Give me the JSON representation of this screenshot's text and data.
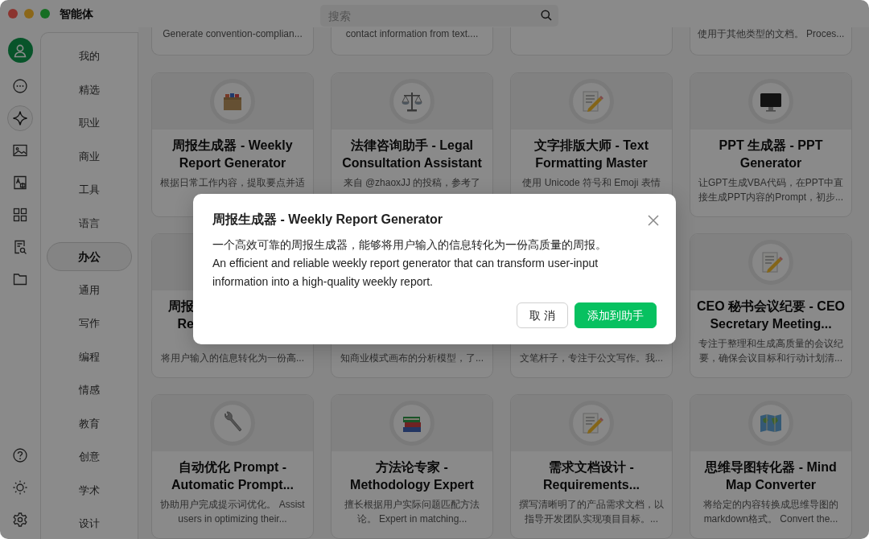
{
  "window": {
    "title": "智能体"
  },
  "search": {
    "placeholder": "搜索"
  },
  "nav_rail": [
    {
      "selected": false
    },
    {
      "selected": true
    },
    {
      "selected": false
    },
    {
      "selected": false
    },
    {
      "selected": false
    },
    {
      "selected": false
    },
    {
      "selected": false
    }
  ],
  "categories": [
    {
      "label": "我的",
      "selected": false
    },
    {
      "label": "精选",
      "selected": false
    },
    {
      "label": "职业",
      "selected": false
    },
    {
      "label": "商业",
      "selected": false
    },
    {
      "label": "工具",
      "selected": false
    },
    {
      "label": "语言",
      "selected": false
    },
    {
      "label": "办公",
      "selected": true
    },
    {
      "label": "通用",
      "selected": false
    },
    {
      "label": "写作",
      "selected": false
    },
    {
      "label": "编程",
      "selected": false
    },
    {
      "label": "情感",
      "selected": false
    },
    {
      "label": "教育",
      "selected": false
    },
    {
      "label": "创意",
      "selected": false
    },
    {
      "label": "学术",
      "selected": false
    },
    {
      "label": "设计",
      "selected": false
    }
  ],
  "cards": [
    {
      "kind": "clipped",
      "description_lines": [
        "Generate convention-complian..."
      ]
    },
    {
      "kind": "clipped",
      "description_lines": [
        "contact information from text...."
      ]
    },
    {
      "kind": "clipped"
    },
    {
      "kind": "clipped",
      "description_lines": [
        "使用于其他类型的文档。 Proces..."
      ]
    },
    {
      "kind": "full",
      "title_lines": [
        "周报生成器 - Weekly",
        "Report Generator"
      ],
      "description_lines": [
        "根据日常工作内容，提取要点并适"
      ]
    },
    {
      "kind": "full",
      "title_lines": [
        "法律咨询助手 - Legal",
        "Consultation Assistant"
      ],
      "description_lines": [
        "来自 @zhaoxJJ 的投稿，参考了"
      ]
    },
    {
      "kind": "full",
      "title_lines": [
        "文字排版大师 - Text",
        "Formatting Master"
      ],
      "description_lines": [
        "使用 Unicode 符号和 Emoji 表情"
      ]
    },
    {
      "kind": "full",
      "title_lines": [
        "PPT 生成器 - PPT",
        "Generator"
      ],
      "description_lines": [
        "让GPT生成VBA代码，在PPT中直",
        "接生成PPT内容的Prompt，初步..."
      ]
    },
    {
      "kind": "covered",
      "title_lines": [
        "周报",
        "Re"
      ],
      "description_lines": [
        "将用户输入的信息转化为一份高..."
      ]
    },
    {
      "kind": "covered",
      "description_lines": [
        "知商业模式画布的分析模型，了..."
      ]
    },
    {
      "kind": "covered",
      "description_lines": [
        "文笔杆子，专注于公文写作。我..."
      ]
    },
    {
      "kind": "full",
      "title_lines": [
        "CEO 秘书会议纪要 - CEO",
        "Secretary Meeting..."
      ],
      "description_lines": [
        "专注于整理和生成高质量的会议纪",
        "要，确保会议目标和行动计划清..."
      ]
    },
    {
      "kind": "full",
      "title_lines": [
        "自动优化 Prompt -",
        "Automatic Prompt..."
      ],
      "description_lines": [
        "协助用户完成提示词优化。 Assist",
        "users in optimizing their..."
      ]
    },
    {
      "kind": "full",
      "title_lines": [
        "方法论专家 -",
        "Methodology Expert"
      ],
      "description_lines": [
        "擅长根据用户实际问题匹配方法",
        "论。 Expert in matching..."
      ]
    },
    {
      "kind": "full",
      "title_lines": [
        "需求文档设计 -",
        "Requirements..."
      ],
      "description_lines": [
        "撰写清晰明了的产品需求文档，以",
        "指导开发团队实现项目目标。..."
      ]
    },
    {
      "kind": "full",
      "title_lines": [
        "思维导图转化器 - Mind",
        "Map Converter"
      ],
      "description_lines": [
        "将给定的内容转换成思维导图的",
        "markdown格式。 Convert the..."
      ]
    }
  ],
  "dialog": {
    "title": "周报生成器 - Weekly Report Generator",
    "body_lines": [
      "一个高效可靠的周报生成器，能够将用户输入的信息转化为一份高质量的周报。",
      "An efficient and reliable weekly report generator that can transform user-input",
      "information into a high-quality weekly report."
    ],
    "buttons": [
      {
        "label": "取 消",
        "kind": "secondary"
      },
      {
        "label": "添加到助手",
        "kind": "primary"
      }
    ]
  }
}
